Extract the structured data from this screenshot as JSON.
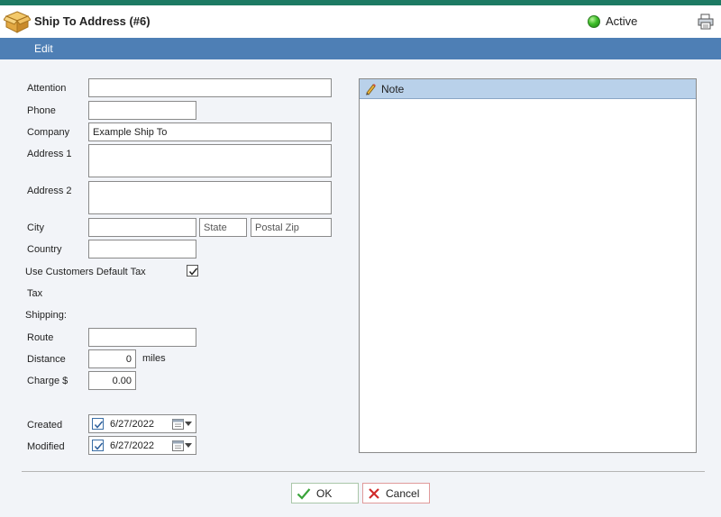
{
  "window": {
    "title": "Ship To Address (#6)",
    "status": "Active",
    "status_color": "#3fbf2a"
  },
  "menu": {
    "edit_label": "Edit"
  },
  "form": {
    "attention": {
      "label": "Attention",
      "value": ""
    },
    "phone": {
      "label": "Phone",
      "value": ""
    },
    "company": {
      "label": "Company",
      "value": "Example Ship To"
    },
    "address1": {
      "label": "Address 1",
      "value": ""
    },
    "address2": {
      "label": "Address 2",
      "value": ""
    },
    "city": {
      "label": "City",
      "value": ""
    },
    "state": {
      "placeholder": "State",
      "value": ""
    },
    "zip": {
      "placeholder": "Postal Zip",
      "value": ""
    },
    "country": {
      "label": "Country",
      "value": ""
    },
    "use_default_tax": {
      "label": "Use Customers Default Tax",
      "checked": true
    },
    "tax": {
      "label": "Tax"
    },
    "shipping": {
      "label": "Shipping:"
    },
    "route": {
      "label": "Route",
      "value": ""
    },
    "distance": {
      "label": "Distance",
      "value": "0",
      "unit": "miles"
    },
    "charge": {
      "label": "Charge $",
      "value": "0.00"
    },
    "created": {
      "label": "Created",
      "value": "6/27/2022",
      "checked": true
    },
    "modified": {
      "label": "Modified",
      "value": "6/27/2022",
      "checked": true
    }
  },
  "note": {
    "title": "Note",
    "value": ""
  },
  "buttons": {
    "ok": "OK",
    "cancel": "Cancel"
  },
  "icons": {
    "title": "package-box-icon",
    "status": "status-dot-icon",
    "print": "print-icon",
    "note": "pencil-icon",
    "ok": "checkmark-icon",
    "cancel": "x-icon",
    "calendar": "calendar-icon"
  }
}
